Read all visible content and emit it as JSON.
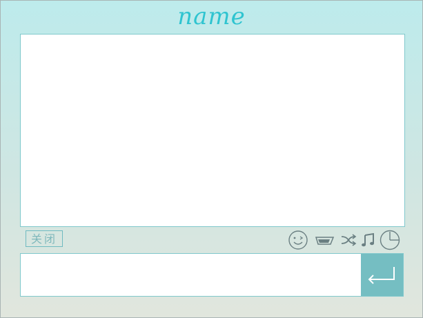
{
  "window": {
    "title": "name"
  },
  "controls": {
    "close_label": "关闭"
  },
  "toolbar": {
    "icons": [
      "emoji-icon",
      "screenshot-icon",
      "shuffle-icon",
      "music-icon",
      "history-clock-icon"
    ]
  },
  "input": {
    "value": "",
    "placeholder": ""
  },
  "send": {
    "icon": "enter-return-icon"
  },
  "colors": {
    "title": "#2fc4d0",
    "border": "#7fc8cc",
    "send_button": "#75bec2",
    "icon": "#6a7f82"
  }
}
